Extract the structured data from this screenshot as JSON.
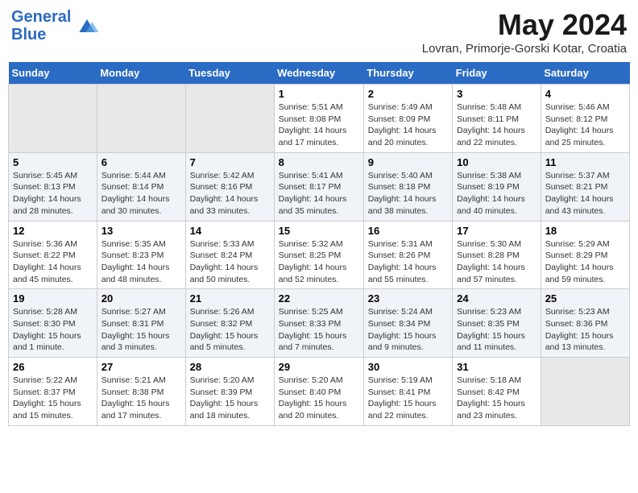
{
  "header": {
    "logo_line1": "General",
    "logo_line2": "Blue",
    "title": "May 2024",
    "subtitle": "Lovran, Primorje-Gorski Kotar, Croatia"
  },
  "days_of_week": [
    "Sunday",
    "Monday",
    "Tuesday",
    "Wednesday",
    "Thursday",
    "Friday",
    "Saturday"
  ],
  "weeks": [
    [
      {
        "day": "",
        "info": ""
      },
      {
        "day": "",
        "info": ""
      },
      {
        "day": "",
        "info": ""
      },
      {
        "day": "1",
        "info": "Sunrise: 5:51 AM\nSunset: 8:08 PM\nDaylight: 14 hours and 17 minutes."
      },
      {
        "day": "2",
        "info": "Sunrise: 5:49 AM\nSunset: 8:09 PM\nDaylight: 14 hours and 20 minutes."
      },
      {
        "day": "3",
        "info": "Sunrise: 5:48 AM\nSunset: 8:11 PM\nDaylight: 14 hours and 22 minutes."
      },
      {
        "day": "4",
        "info": "Sunrise: 5:46 AM\nSunset: 8:12 PM\nDaylight: 14 hours and 25 minutes."
      }
    ],
    [
      {
        "day": "5",
        "info": "Sunrise: 5:45 AM\nSunset: 8:13 PM\nDaylight: 14 hours and 28 minutes."
      },
      {
        "day": "6",
        "info": "Sunrise: 5:44 AM\nSunset: 8:14 PM\nDaylight: 14 hours and 30 minutes."
      },
      {
        "day": "7",
        "info": "Sunrise: 5:42 AM\nSunset: 8:16 PM\nDaylight: 14 hours and 33 minutes."
      },
      {
        "day": "8",
        "info": "Sunrise: 5:41 AM\nSunset: 8:17 PM\nDaylight: 14 hours and 35 minutes."
      },
      {
        "day": "9",
        "info": "Sunrise: 5:40 AM\nSunset: 8:18 PM\nDaylight: 14 hours and 38 minutes."
      },
      {
        "day": "10",
        "info": "Sunrise: 5:38 AM\nSunset: 8:19 PM\nDaylight: 14 hours and 40 minutes."
      },
      {
        "day": "11",
        "info": "Sunrise: 5:37 AM\nSunset: 8:21 PM\nDaylight: 14 hours and 43 minutes."
      }
    ],
    [
      {
        "day": "12",
        "info": "Sunrise: 5:36 AM\nSunset: 8:22 PM\nDaylight: 14 hours and 45 minutes."
      },
      {
        "day": "13",
        "info": "Sunrise: 5:35 AM\nSunset: 8:23 PM\nDaylight: 14 hours and 48 minutes."
      },
      {
        "day": "14",
        "info": "Sunrise: 5:33 AM\nSunset: 8:24 PM\nDaylight: 14 hours and 50 minutes."
      },
      {
        "day": "15",
        "info": "Sunrise: 5:32 AM\nSunset: 8:25 PM\nDaylight: 14 hours and 52 minutes."
      },
      {
        "day": "16",
        "info": "Sunrise: 5:31 AM\nSunset: 8:26 PM\nDaylight: 14 hours and 55 minutes."
      },
      {
        "day": "17",
        "info": "Sunrise: 5:30 AM\nSunset: 8:28 PM\nDaylight: 14 hours and 57 minutes."
      },
      {
        "day": "18",
        "info": "Sunrise: 5:29 AM\nSunset: 8:29 PM\nDaylight: 14 hours and 59 minutes."
      }
    ],
    [
      {
        "day": "19",
        "info": "Sunrise: 5:28 AM\nSunset: 8:30 PM\nDaylight: 15 hours and 1 minute."
      },
      {
        "day": "20",
        "info": "Sunrise: 5:27 AM\nSunset: 8:31 PM\nDaylight: 15 hours and 3 minutes."
      },
      {
        "day": "21",
        "info": "Sunrise: 5:26 AM\nSunset: 8:32 PM\nDaylight: 15 hours and 5 minutes."
      },
      {
        "day": "22",
        "info": "Sunrise: 5:25 AM\nSunset: 8:33 PM\nDaylight: 15 hours and 7 minutes."
      },
      {
        "day": "23",
        "info": "Sunrise: 5:24 AM\nSunset: 8:34 PM\nDaylight: 15 hours and 9 minutes."
      },
      {
        "day": "24",
        "info": "Sunrise: 5:23 AM\nSunset: 8:35 PM\nDaylight: 15 hours and 11 minutes."
      },
      {
        "day": "25",
        "info": "Sunrise: 5:23 AM\nSunset: 8:36 PM\nDaylight: 15 hours and 13 minutes."
      }
    ],
    [
      {
        "day": "26",
        "info": "Sunrise: 5:22 AM\nSunset: 8:37 PM\nDaylight: 15 hours and 15 minutes."
      },
      {
        "day": "27",
        "info": "Sunrise: 5:21 AM\nSunset: 8:38 PM\nDaylight: 15 hours and 17 minutes."
      },
      {
        "day": "28",
        "info": "Sunrise: 5:20 AM\nSunset: 8:39 PM\nDaylight: 15 hours and 18 minutes."
      },
      {
        "day": "29",
        "info": "Sunrise: 5:20 AM\nSunset: 8:40 PM\nDaylight: 15 hours and 20 minutes."
      },
      {
        "day": "30",
        "info": "Sunrise: 5:19 AM\nSunset: 8:41 PM\nDaylight: 15 hours and 22 minutes."
      },
      {
        "day": "31",
        "info": "Sunrise: 5:18 AM\nSunset: 8:42 PM\nDaylight: 15 hours and 23 minutes."
      },
      {
        "day": "",
        "info": ""
      }
    ]
  ]
}
